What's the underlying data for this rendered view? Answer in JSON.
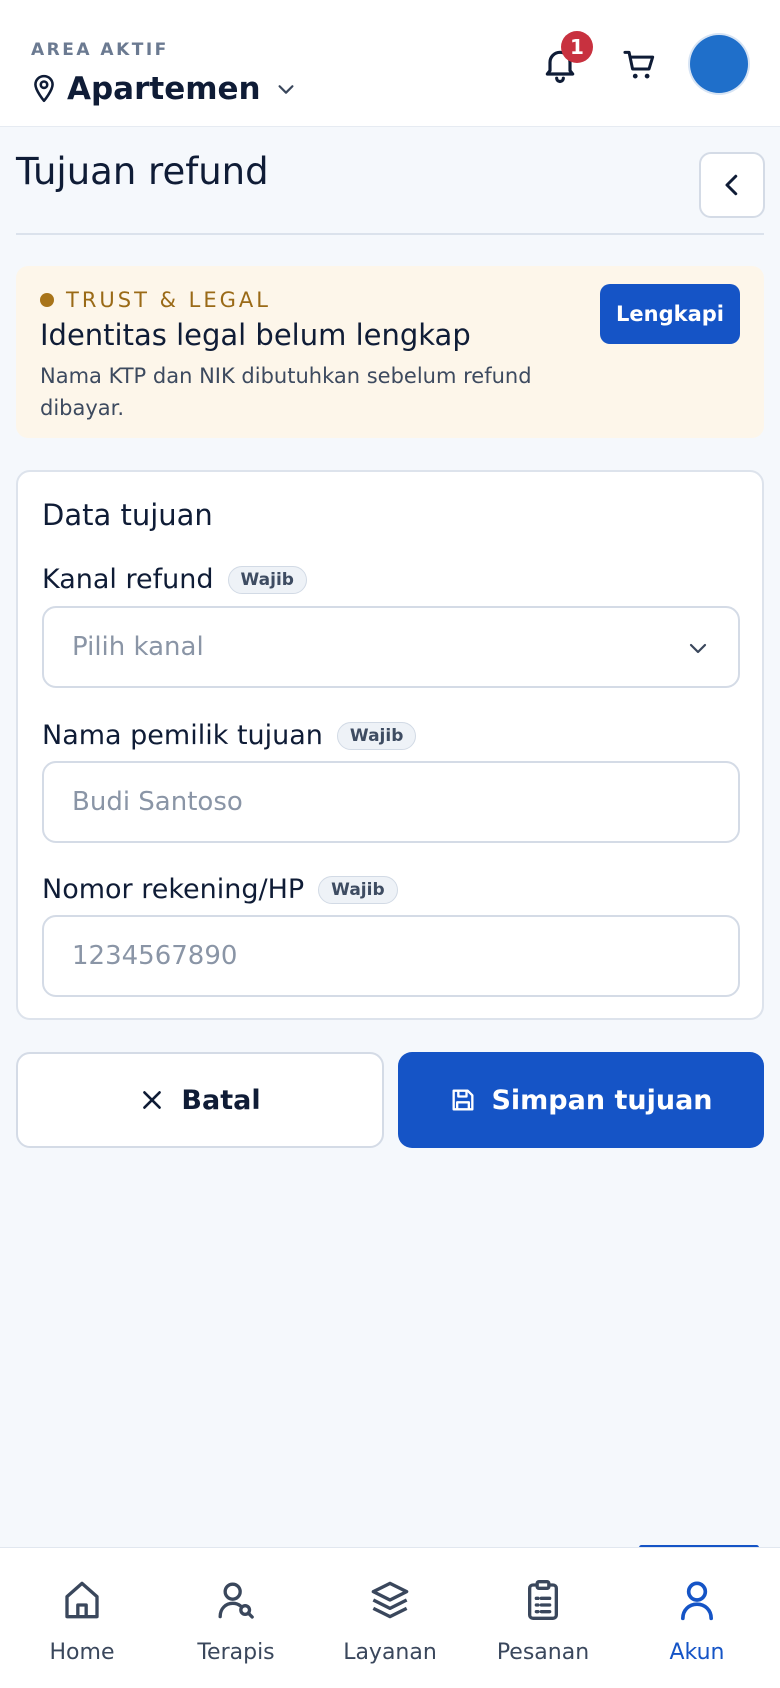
{
  "header": {
    "area_label": "AREA AKTIF",
    "area_name": "Apartemen",
    "notification_count": "1"
  },
  "page": {
    "title": "Tujuan refund"
  },
  "trust_banner": {
    "tag": "TRUST & LEGAL",
    "title": "Identitas legal belum lengkap",
    "description": "Nama KTP dan NIK dibutuhkan sebelum refund dibayar.",
    "action_label": "Lengkapi"
  },
  "form": {
    "title": "Data tujuan",
    "required_badge": "Wajib",
    "channel": {
      "label": "Kanal refund",
      "placeholder": "Pilih kanal"
    },
    "owner_name": {
      "label": "Nama pemilik tujuan",
      "placeholder": "Budi Santoso"
    },
    "account_number": {
      "label": "Nomor rekening/HP",
      "placeholder": "1234567890"
    }
  },
  "actions": {
    "cancel_label": "Batal",
    "save_label": "Simpan tujuan"
  },
  "bottom_nav": {
    "items": [
      {
        "label": "Home",
        "icon": "home-icon"
      },
      {
        "label": "Terapis",
        "icon": "therapist-icon"
      },
      {
        "label": "Layanan",
        "icon": "layers-icon"
      },
      {
        "label": "Pesanan",
        "icon": "clipboard-icon"
      },
      {
        "label": "Akun",
        "icon": "user-icon"
      }
    ],
    "active_index": 4
  },
  "colors": {
    "primary": "#1554c6",
    "badge": "#c8313f",
    "warning_bg": "#fdf6ea",
    "warning_text": "#9a6a17"
  }
}
